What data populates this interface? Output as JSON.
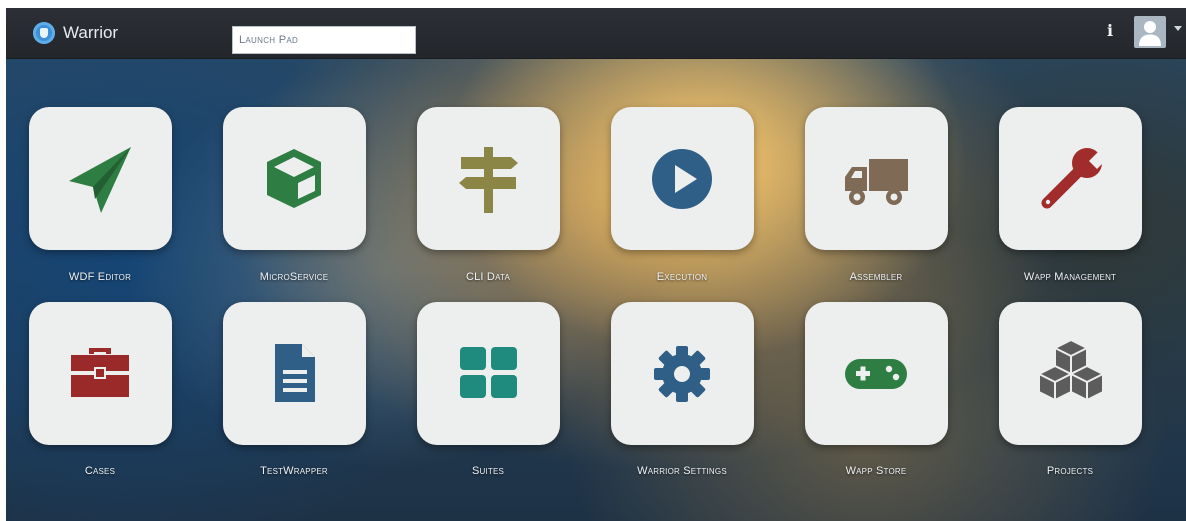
{
  "header": {
    "app_title": "Warrior",
    "page_field_value": "Launch Pad",
    "info_label": "i"
  },
  "tiles": [
    {
      "label": "WDF Editor",
      "icon": "paper-plane-icon",
      "color": "#2e7d43"
    },
    {
      "label": "MicroService",
      "icon": "cube-icon",
      "color": "#2e7d43"
    },
    {
      "label": "CLI Data",
      "icon": "signpost-icon",
      "color": "#8c8646"
    },
    {
      "label": "Execution",
      "icon": "play-circle-icon",
      "color": "#2f5f86"
    },
    {
      "label": "Assembler",
      "icon": "truck-icon",
      "color": "#7e6a55"
    },
    {
      "label": "Wapp Management",
      "icon": "wrench-icon",
      "color": "#a12c2c"
    },
    {
      "label": "Cases",
      "icon": "briefcase-icon",
      "color": "#9a2a2a"
    },
    {
      "label": "TestWrapper",
      "icon": "document-icon",
      "color": "#2f5f86"
    },
    {
      "label": "Suites",
      "icon": "grid-icon",
      "color": "#1f8a7e"
    },
    {
      "label": "Warrior Settings",
      "icon": "gear-icon",
      "color": "#2f5f86"
    },
    {
      "label": "Wapp Store",
      "icon": "gamepad-icon",
      "color": "#2e7d43"
    },
    {
      "label": "Projects",
      "icon": "cubes-icon",
      "color": "#5c5c5c"
    }
  ]
}
